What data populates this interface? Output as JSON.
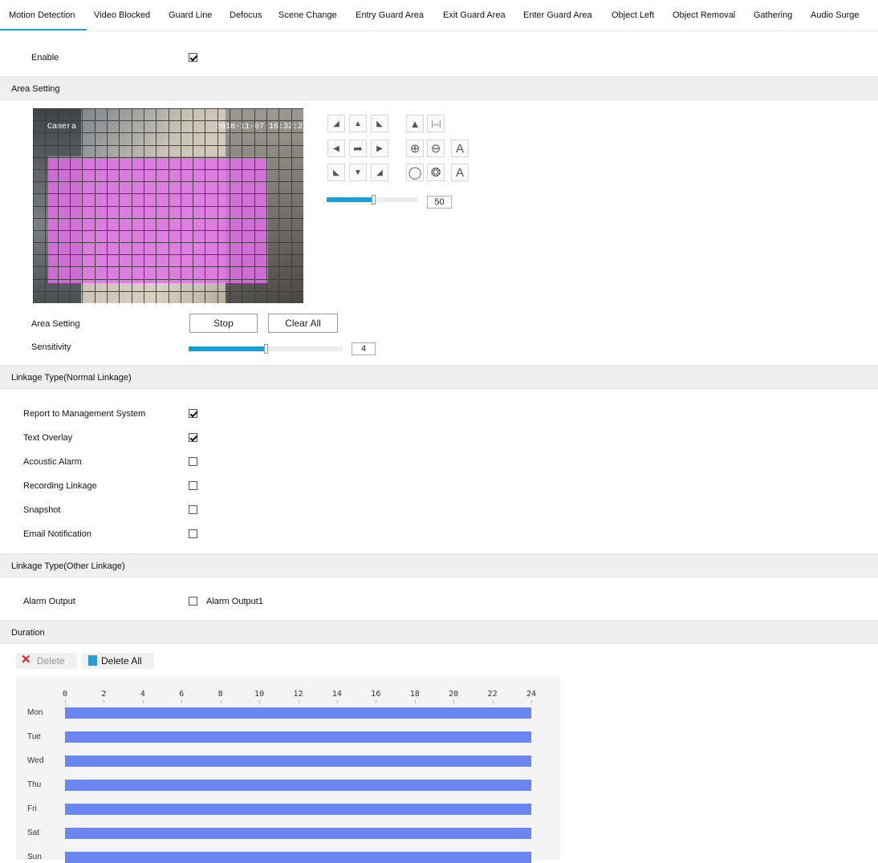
{
  "tabs": [
    "Motion Detection",
    "Video Blocked",
    "Guard Line",
    "Defocus",
    "Scene Change",
    "Entry Guard Area",
    "Exit Guard Area",
    "Enter Guard Area",
    "Object Left",
    "Object Removal",
    "Gathering",
    "Audio Surge"
  ],
  "active_tab": "Motion Detection",
  "enable": {
    "label": "Enable",
    "checked": true
  },
  "area_section": {
    "title": "Area Setting"
  },
  "video": {
    "osd_name": "Camera",
    "osd_time": "2018-11-07 16:32:2",
    "grid_color": "#3a3a3a",
    "mask_color": "#e070e6"
  },
  "ptz": {
    "speed_value": "50",
    "speed_fraction": 0.51
  },
  "area_setting": {
    "label": "Area Setting",
    "stop_button": "Stop",
    "clear_all_button": "Clear All"
  },
  "sensitivity": {
    "label": "Sensitivity",
    "value": "4",
    "fraction": 0.5
  },
  "normal_linkage": {
    "title": "Linkage Type(Normal Linkage)",
    "items": [
      {
        "label": "Report to Management System",
        "checked": true
      },
      {
        "label": "Text Overlay",
        "checked": true
      },
      {
        "label": "Acoustic Alarm",
        "checked": false
      },
      {
        "label": "Recording Linkage",
        "checked": false
      },
      {
        "label": "Snapshot",
        "checked": false
      },
      {
        "label": "Email Notification",
        "checked": false
      }
    ]
  },
  "other_linkage": {
    "title": "Linkage Type(Other Linkage)",
    "alarm_output_label": "Alarm Output",
    "alarm_output1": "Alarm Output1",
    "alarm_output1_checked": false
  },
  "duration": {
    "title": "Duration",
    "delete_label": "Delete",
    "delete_all_label": "Delete All",
    "hours": [
      "0",
      "2",
      "4",
      "6",
      "8",
      "10",
      "12",
      "14",
      "16",
      "18",
      "20",
      "22",
      "24"
    ],
    "days": [
      "Mon",
      "Tue",
      "Wed",
      "Thu",
      "Fri",
      "Sat",
      "Sun"
    ],
    "bar_color": "#6b86f0"
  }
}
